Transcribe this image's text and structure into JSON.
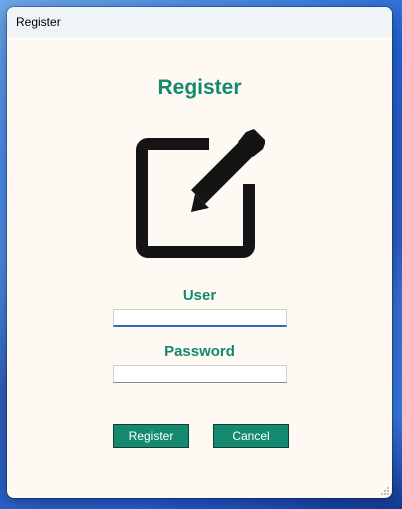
{
  "window": {
    "title": "Register"
  },
  "form": {
    "heading": "Register",
    "icon": "edit-icon",
    "user_label": "User",
    "user_value": "",
    "password_label": "Password",
    "password_value": ""
  },
  "buttons": {
    "register_label": "Register",
    "cancel_label": "Cancel"
  },
  "colors": {
    "accent": "#138a6f",
    "button_bg": "#158a70",
    "window_bg": "#fff9f3",
    "titlebar_bg": "#eff4f9",
    "focus_underline": "#2a6ab8"
  }
}
